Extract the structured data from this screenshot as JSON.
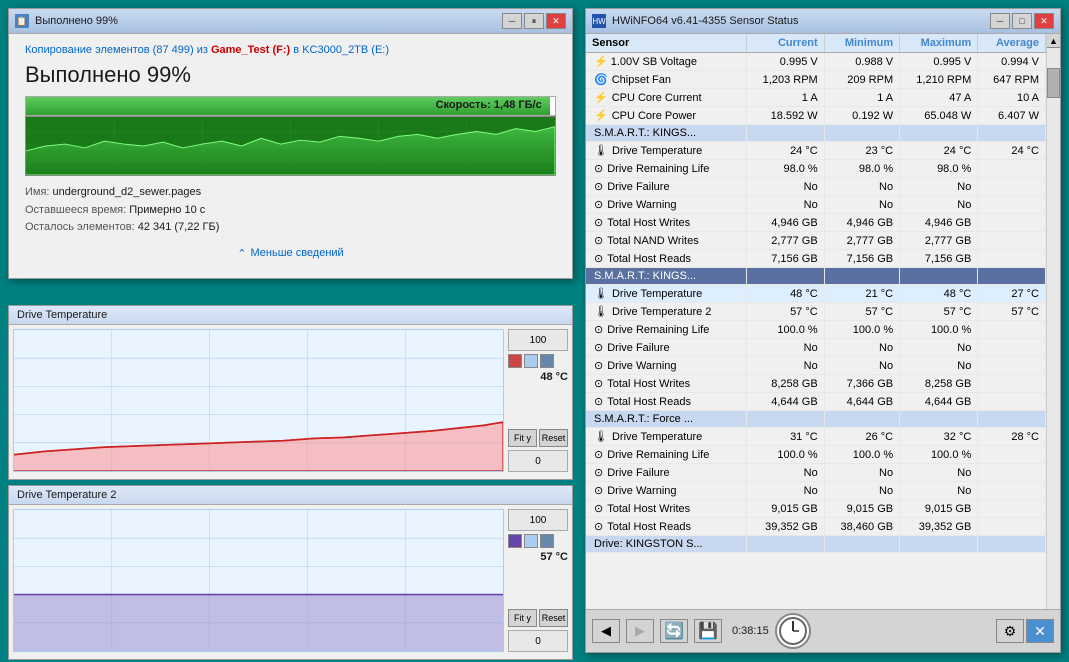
{
  "copyDialog": {
    "title": "Выполнено 99%",
    "iconLabel": "📋",
    "source": "Копирование элементов (87 499) из",
    "fromLabel": "Game_Test (F:)",
    "toLabel": "в KC3000_2TB (E:)",
    "percent": "Выполнено 99%",
    "speedLabel": "Скорость: 1,48 ГБ/с",
    "fileName": "underground_d2_sewer.pages",
    "timeLeft": "Примерно 10 с",
    "remaining": "42 341 (7,22 ГБ)",
    "fileNameLabel": "Имя:",
    "timeLabel": "Оставшееся время:",
    "remainingLabel": "Осталось элементов:",
    "lessDetails": "Меньше сведений",
    "pauseBtn": "⏸",
    "closeBtn": "✕",
    "minBtn": "─",
    "maxBtn": "□"
  },
  "chart1": {
    "title": "Drive Temperature",
    "value100": "100",
    "value0": "0",
    "currentVal": "48 °C",
    "fitBtn": "Fit y",
    "resetBtn": "Reset"
  },
  "chart2": {
    "title": "Drive Temperature 2",
    "value100": "100",
    "value0": "0",
    "currentVal": "57 °C",
    "fitBtn": "Fit y",
    "resetBtn": "Reset"
  },
  "hwinfo": {
    "title": "HWiNFO64 v6.41-4355 Sensor Status",
    "minBtn": "─",
    "maxBtn": "□",
    "closeBtn": "✕",
    "columns": [
      "Sensor",
      "Current",
      "Minimum",
      "Maximum",
      "Average"
    ],
    "sections": [
      {
        "type": "header",
        "cells": [
          "⚡ 1.00V SB Voltage",
          "0.995 V",
          "0.988 V",
          "0.995 V",
          "0.994 V"
        ],
        "style": "normal"
      },
      {
        "type": "row",
        "icon": "fan",
        "cells": [
          "  Chipset Fan",
          "1,203 RPM",
          "209 RPM",
          "1,210 RPM",
          "647 RPM"
        ],
        "style": "normal"
      },
      {
        "type": "row",
        "icon": "cpu",
        "cells": [
          "  CPU Core Current",
          "1 A",
          "1 A",
          "47 A",
          "10 A"
        ],
        "style": "normal"
      },
      {
        "type": "row",
        "icon": "cpu",
        "cells": [
          "  CPU Core Power",
          "18.592 W",
          "0.192 W",
          "65.048 W",
          "6.407 W"
        ],
        "style": "normal"
      },
      {
        "type": "section-header",
        "cells": [
          "S.M.A.R.T.: KINGS...",
          "",
          "",
          "",
          ""
        ],
        "style": "light-blue"
      },
      {
        "type": "row",
        "icon": "temp",
        "cells": [
          "  Drive Temperature",
          "24 °C",
          "23 °C",
          "24 °C",
          "24 °C"
        ],
        "style": "normal"
      },
      {
        "type": "row",
        "icon": "circle",
        "cells": [
          "  Drive Remaining Life",
          "98.0 %",
          "98.0 %",
          "98.0 %",
          ""
        ],
        "style": "normal"
      },
      {
        "type": "row",
        "icon": "circle",
        "cells": [
          "  Drive Failure",
          "No",
          "No",
          "No",
          ""
        ],
        "style": "normal"
      },
      {
        "type": "row",
        "icon": "circle",
        "cells": [
          "  Drive Warning",
          "No",
          "No",
          "No",
          ""
        ],
        "style": "normal"
      },
      {
        "type": "row",
        "icon": "circle",
        "cells": [
          "  Total Host Writes",
          "4,946 GB",
          "4,946 GB",
          "4,946 GB",
          ""
        ],
        "style": "normal"
      },
      {
        "type": "row",
        "icon": "circle",
        "cells": [
          "  Total NAND Writes",
          "2,777 GB",
          "2,777 GB",
          "2,777 GB",
          ""
        ],
        "style": "normal"
      },
      {
        "type": "row",
        "icon": "circle",
        "cells": [
          "  Total Host Reads",
          "7,156 GB",
          "7,156 GB",
          "7,156 GB",
          ""
        ],
        "style": "normal"
      },
      {
        "type": "section-header",
        "cells": [
          "S.M.A.R.T.: KINGS...",
          "",
          "",
          "",
          ""
        ],
        "style": "dark-blue"
      },
      {
        "type": "row",
        "icon": "temp",
        "cells": [
          "  Drive Temperature",
          "48 °C",
          "21 °C",
          "48 °C",
          "27 °C"
        ],
        "style": "highlight"
      },
      {
        "type": "row",
        "icon": "temp",
        "cells": [
          "  Drive Temperature 2",
          "57 °C",
          "57 °C",
          "57 °C",
          "57 °C"
        ],
        "style": "normal"
      },
      {
        "type": "row",
        "icon": "circle",
        "cells": [
          "  Drive Remaining Life",
          "100.0 %",
          "100.0 %",
          "100.0 %",
          ""
        ],
        "style": "normal"
      },
      {
        "type": "row",
        "icon": "circle",
        "cells": [
          "  Drive Failure",
          "No",
          "No",
          "No",
          ""
        ],
        "style": "normal"
      },
      {
        "type": "row",
        "icon": "circle",
        "cells": [
          "  Drive Warning",
          "No",
          "No",
          "No",
          ""
        ],
        "style": "normal"
      },
      {
        "type": "row",
        "icon": "circle",
        "cells": [
          "  Total Host Writes",
          "8,258 GB",
          "7,366 GB",
          "8,258 GB",
          ""
        ],
        "style": "normal"
      },
      {
        "type": "row",
        "icon": "circle",
        "cells": [
          "  Total Host Reads",
          "4,644 GB",
          "4,644 GB",
          "4,644 GB",
          ""
        ],
        "style": "normal"
      },
      {
        "type": "section-header",
        "cells": [
          "S.M.A.R.T.: Force ...",
          "",
          "",
          "",
          ""
        ],
        "style": "light-blue"
      },
      {
        "type": "row",
        "icon": "temp",
        "cells": [
          "  Drive Temperature",
          "31 °C",
          "26 °C",
          "32 °C",
          "28 °C"
        ],
        "style": "normal"
      },
      {
        "type": "row",
        "icon": "circle",
        "cells": [
          "  Drive Remaining Life",
          "100.0 %",
          "100.0 %",
          "100.0 %",
          ""
        ],
        "style": "normal"
      },
      {
        "type": "row",
        "icon": "circle",
        "cells": [
          "  Drive Failure",
          "No",
          "No",
          "No",
          ""
        ],
        "style": "normal"
      },
      {
        "type": "row",
        "icon": "circle",
        "cells": [
          "  Drive Warning",
          "No",
          "No",
          "No",
          ""
        ],
        "style": "normal"
      },
      {
        "type": "row",
        "icon": "circle",
        "cells": [
          "  Total Host Writes",
          "9,015 GB",
          "9,015 GB",
          "9,015 GB",
          ""
        ],
        "style": "normal"
      },
      {
        "type": "row",
        "icon": "circle",
        "cells": [
          "  Total Host Reads",
          "39,352 GB",
          "38,460 GB",
          "39,352 GB",
          ""
        ],
        "style": "normal"
      },
      {
        "type": "section-header",
        "cells": [
          "Drive: KINGSTON S...",
          "",
          "",
          "",
          ""
        ],
        "style": "light-blue"
      }
    ],
    "taskbar": {
      "backBtn": "◀",
      "forwardBtn": "▶",
      "time": "0:38:15",
      "icons": [
        "🔄",
        "💾",
        "⚙",
        "✕"
      ]
    }
  }
}
